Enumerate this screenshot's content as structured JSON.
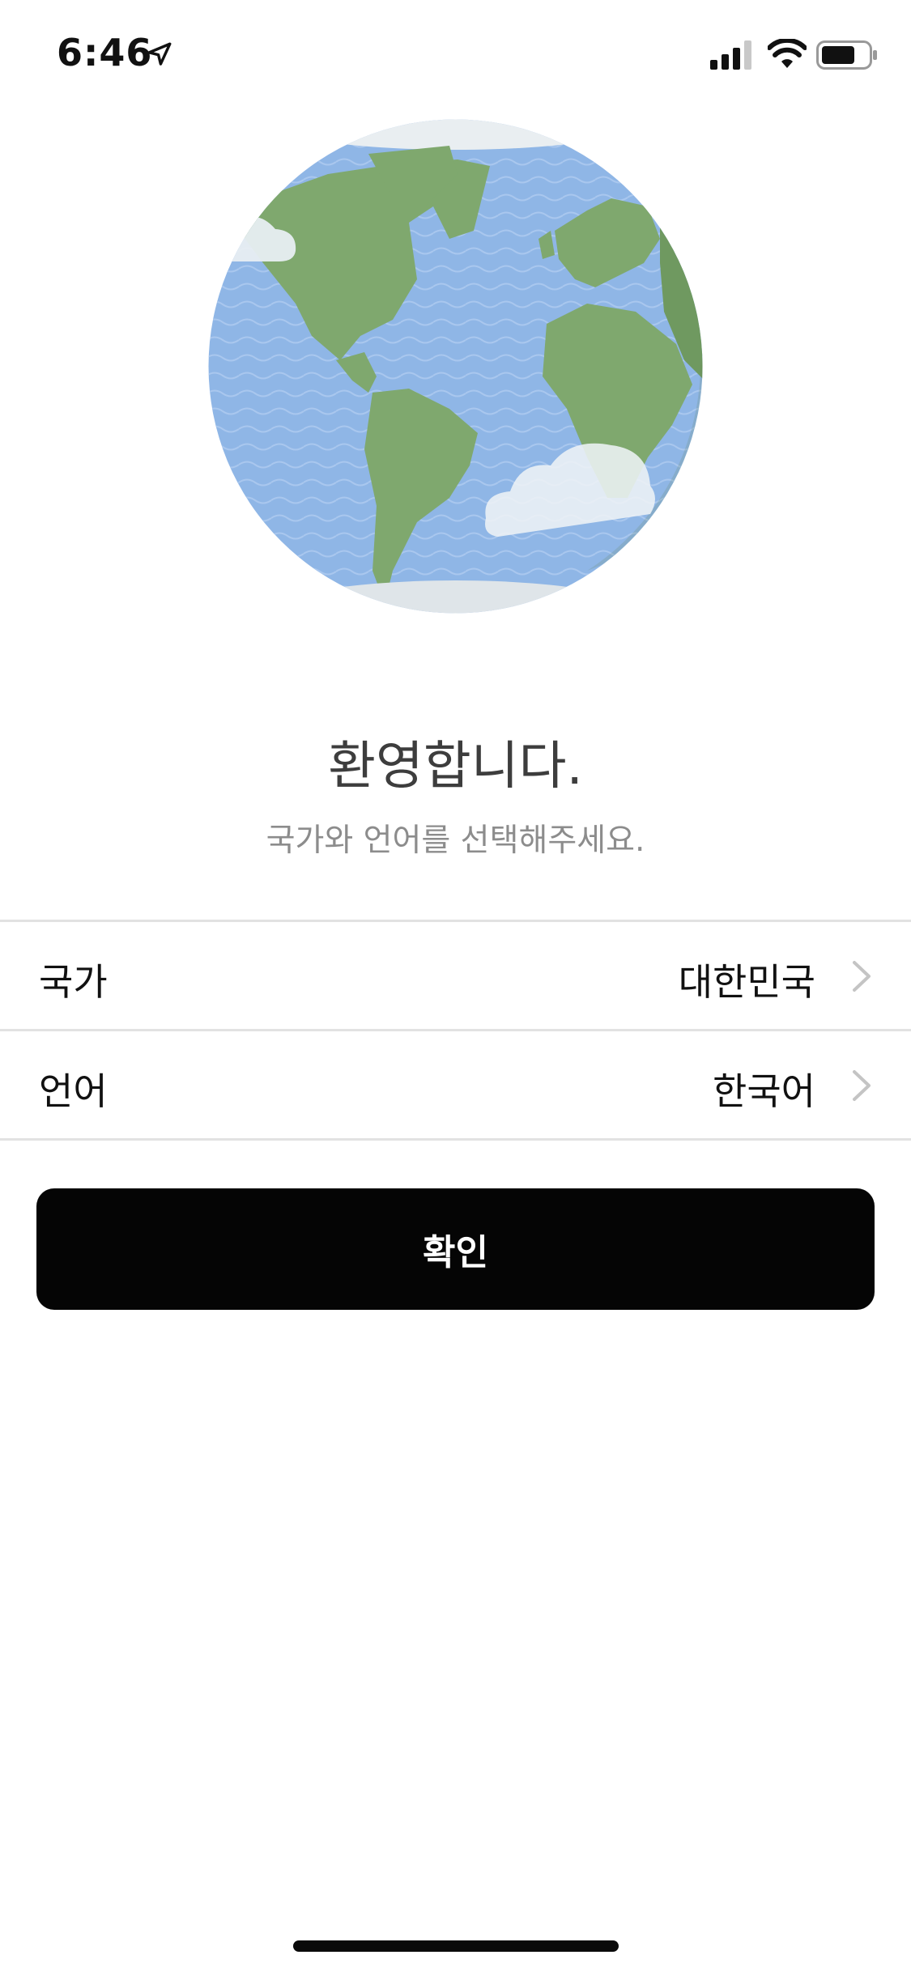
{
  "status_bar": {
    "time": "6:46",
    "icons": [
      "location-arrow-icon",
      "cellular-signal-icon",
      "wifi-icon",
      "battery-icon"
    ]
  },
  "illustration": {
    "icon": "globe-illustration",
    "colors": {
      "ocean": "#8fb6e6",
      "land": "#7fa86e",
      "cloud": "#e8eef2"
    }
  },
  "welcome": {
    "title": "환영합니다.",
    "subtitle": "국가와 언어를 선택해주세요."
  },
  "settings": {
    "rows": [
      {
        "label": "국가",
        "value": "대한민국"
      },
      {
        "label": "언어",
        "value": "한국어"
      }
    ]
  },
  "confirm": {
    "label": "확인",
    "color": "#050505"
  }
}
